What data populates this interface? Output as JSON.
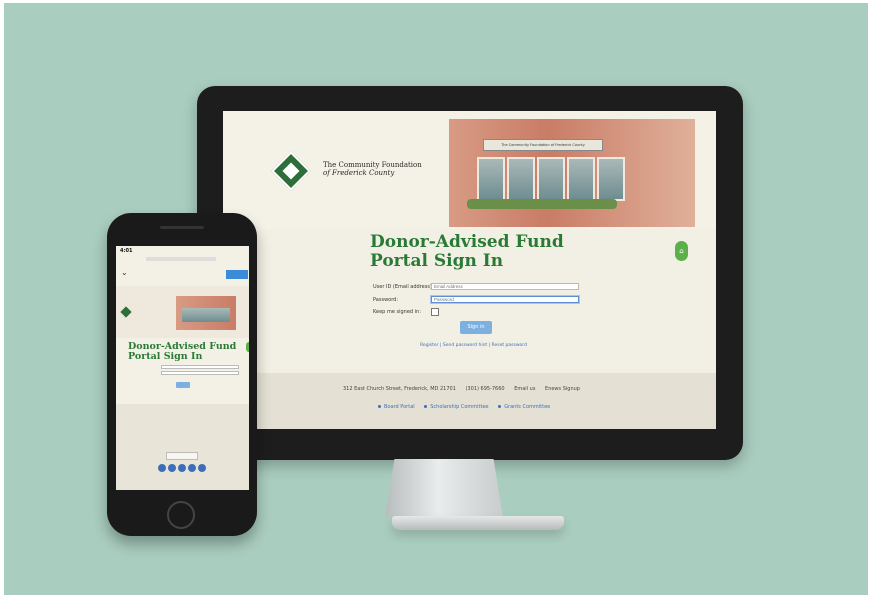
{
  "screen": {
    "logo_line1": "The Community Foundation",
    "logo_line2": "of Frederick County",
    "building_sign": "The Community Foundation of Frederick County",
    "title_line1": "Donor-Advised Fund",
    "title_line2": "Portal Sign In",
    "user_id_label": "User ID (Email address):",
    "user_id_placeholder": "Email Address",
    "password_label": "Password:",
    "password_placeholder": "Password",
    "keep_signed_label": "Keep me signed in:",
    "signin_label": "Sign in",
    "register_links": "Register | Send password hint | Reset password",
    "footer_address": "312 East Church Street, Frederick, MD 21701",
    "footer_phone": "(301) 695-7660",
    "footer_email": "Email us",
    "footer_enews": "Enews Signup",
    "footer_link_board": "Board Portal",
    "footer_link_scholarship": "Scholarship Committee",
    "footer_link_grants": "Grants Committee"
  },
  "phone": {
    "time": "4:01",
    "title_line1": "Donor-Advised Fund",
    "title_line2": "Portal Sign In"
  },
  "colors": {
    "background": "#a9cdbf",
    "accent_green": "#2a7a36",
    "link_blue": "#3d6fb8",
    "button_blue": "#7cb0e0"
  }
}
